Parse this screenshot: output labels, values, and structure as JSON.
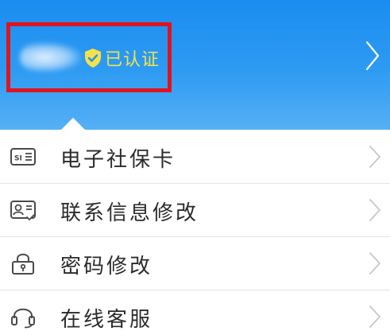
{
  "header": {
    "verify_badge_icon": "shield-check-icon",
    "verify_text": "已认证",
    "arrow_icon": "chevron-right-icon"
  },
  "colors": {
    "header_blue": "#1b8df0",
    "verify_yellow": "#f4e24a",
    "highlight_red": "#e0141e"
  },
  "menu": {
    "items": [
      {
        "label": "电子社保卡",
        "icon": "social-security-card-icon"
      },
      {
        "label": "联系信息修改",
        "icon": "contact-card-icon"
      },
      {
        "label": "密码修改",
        "icon": "lock-icon"
      },
      {
        "label": "在线客服",
        "icon": "headset-icon"
      }
    ]
  }
}
